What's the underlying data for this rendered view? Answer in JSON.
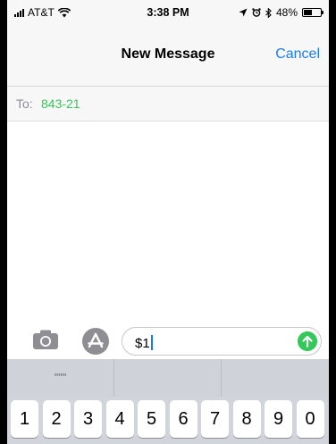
{
  "status_bar": {
    "carrier": "AT&T",
    "time": "3:38 PM",
    "battery": "48%",
    "icons": [
      "signal-bars-icon",
      "wifi-icon",
      "location-arrow-icon",
      "alarm-icon",
      "bluetooth-icon",
      "battery-icon"
    ]
  },
  "navbar": {
    "title": "New Message",
    "cancel_label": "Cancel"
  },
  "recipient": {
    "label": "To:",
    "value": "843-21"
  },
  "composer": {
    "text": "$1",
    "icons": [
      "camera-icon",
      "app-store-icon",
      "send-arrow-icon"
    ]
  },
  "keyboard": {
    "suggestions": [
      "\"\"\"",
      "",
      ""
    ],
    "digits": [
      "1",
      "2",
      "3",
      "4",
      "5",
      "6",
      "7",
      "8",
      "9",
      "0"
    ]
  },
  "colors": {
    "accent_blue": "#1a7cf5",
    "accent_green": "#34c759"
  }
}
